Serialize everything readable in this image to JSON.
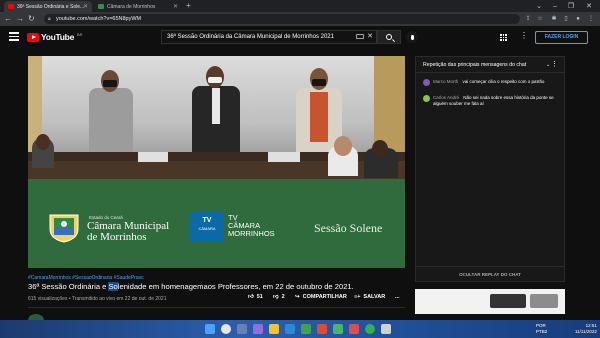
{
  "browser": {
    "tabs": [
      {
        "title": "36ª Sessão Ordinária e Sole...",
        "active": true
      },
      {
        "title": "Câmara de Morrinhos",
        "active": false
      }
    ],
    "new_tab": "+",
    "url": "youtube.com/watch?v=65N8pyWM"
  },
  "youtube": {
    "logo": "YouTube",
    "country": "BR",
    "search_value": "36ª Sessão Ordinária da Câmara Municipal de Morrinhos 2021",
    "sign_in": "FAZER LOGIN"
  },
  "video": {
    "banner": {
      "org_top": "Estado do Ceará",
      "org_line1": "Câmara Municipal",
      "org_line2": "de Morrinhos",
      "tv_logo": "TV",
      "tv_logo_sub": "CÂMARA",
      "tv_text_line1": "TV",
      "tv_text_line2": "CÂMARA",
      "tv_text_line3": "MORRINHOS",
      "session": "Sessão Solene"
    },
    "tags": "#CamaraMorrinhos #SessaoOrdinaria #SaudePravc",
    "title_pre": "36ª Sessão Ordinária e ",
    "title_hl": "So",
    "title_post": "lenidade em homenagemaos Professores, em 22 de outubro de 2021.",
    "meta": "615 visualizações • Transmitido ao vivo em 22 de out. de 2021",
    "likes": "51",
    "dislikes": "2",
    "share": "COMPARTILHAR",
    "save": "SALVAR",
    "more": "..."
  },
  "chat": {
    "header": "Repetição das principais mensagens do chat",
    "messages": [
      {
        "author": "Marco Morth",
        "text": "vai começar cilia o respeito com o patrão",
        "color": "#7e57c2"
      },
      {
        "author": "Carlos André",
        "text": "Não sei nada sobre essa história da ponte se alguém souber me fala aí",
        "color": "#8bc34a"
      }
    ],
    "footer": "OCULTAR REPLAY DO CHAT"
  },
  "taskbar": {
    "lang_top": "POR",
    "lang_bottom": "PTB2",
    "time": "12:51",
    "date": "11/11/2022"
  }
}
